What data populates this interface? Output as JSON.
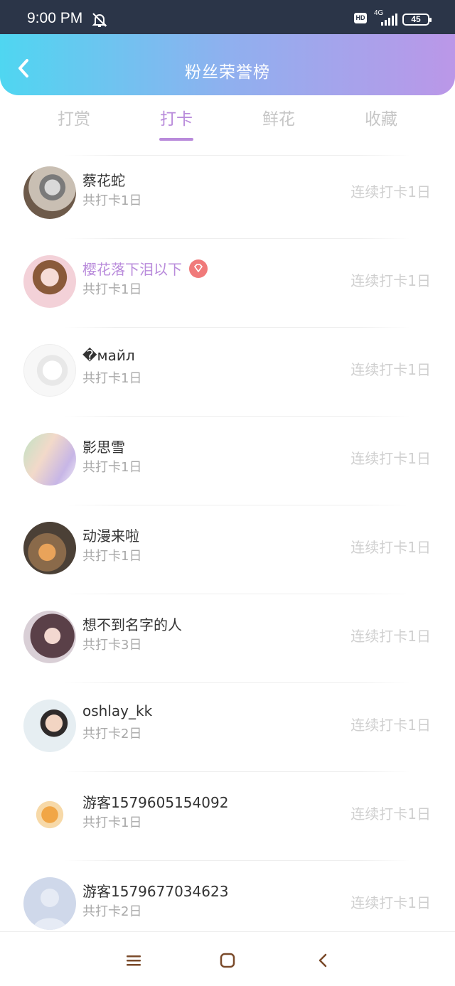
{
  "status": {
    "time": "9:00 PM",
    "hd": "HD",
    "network": "4G",
    "battery": "45"
  },
  "header": {
    "title": "粉丝荣誉榜",
    "back_icon": "chevron-left-icon"
  },
  "tabs": [
    {
      "label": "打赏",
      "active": false
    },
    {
      "label": "打卡",
      "active": true
    },
    {
      "label": "鲜花",
      "active": false
    },
    {
      "label": "收藏",
      "active": false
    }
  ],
  "fans": [
    {
      "name": "蔡花蛇",
      "total": "共打卡1日",
      "streak": "连续打卡1日",
      "vip": false,
      "avatar": "cat-photo"
    },
    {
      "name": "樱花落下泪以下",
      "total": "共打卡1日",
      "streak": "连续打卡1日",
      "vip": true,
      "avatar": "anime-girl-pink"
    },
    {
      "name": "�майл",
      "total": "共打卡1日",
      "streak": "连续打卡1日",
      "vip": false,
      "avatar": "sketch-portrait"
    },
    {
      "name": "影思雪",
      "total": "共打卡1日",
      "streak": "连续打卡1日",
      "vip": false,
      "avatar": "anime-couple"
    },
    {
      "name": "动漫来啦",
      "total": "共打卡1日",
      "streak": "连续打卡1日",
      "vip": false,
      "avatar": "mushroom-art"
    },
    {
      "name": "想不到名字的人",
      "total": "共打卡3日",
      "streak": "连续打卡1日",
      "vip": false,
      "avatar": "anime-girl-dark"
    },
    {
      "name": "oshlay_kk",
      "total": "共打卡2日",
      "streak": "连续打卡1日",
      "vip": false,
      "avatar": "boy-photo"
    },
    {
      "name": "游客1579605154092",
      "total": "共打卡1日",
      "streak": "连续打卡1日",
      "vip": false,
      "avatar": "fox-sticker"
    },
    {
      "name": "游客1579677034623",
      "total": "共打卡2日",
      "streak": "连续打卡1日",
      "vip": false,
      "avatar": "default-user"
    }
  ],
  "colors": {
    "accent": "#b98bdb",
    "gradient_start": "#4fd6f1",
    "gradient_end": "#bb97e8",
    "muted": "#cfcfcf"
  },
  "navbar": {
    "menu_icon": "menu-icon",
    "home_icon": "home-square-icon",
    "back_icon": "back-chevron-icon"
  }
}
